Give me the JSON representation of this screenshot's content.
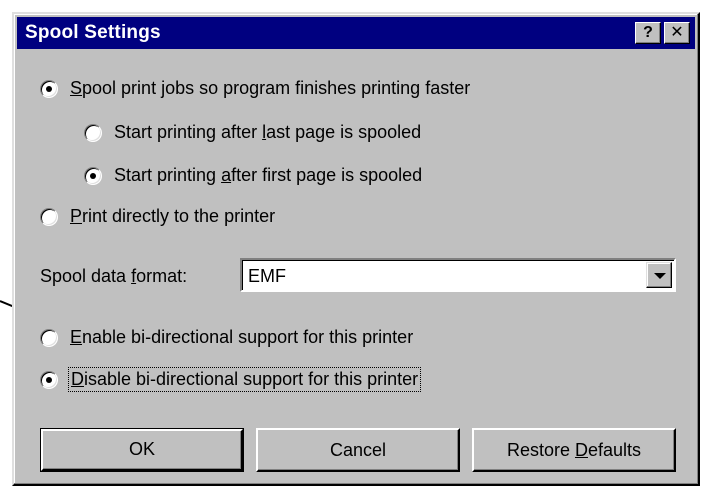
{
  "window": {
    "title": "Spool Settings",
    "help_glyph": "?",
    "close_glyph": "✕"
  },
  "spool_options": {
    "spool": {
      "pre": "",
      "key": "S",
      "post": "pool print jobs so program finishes printing faster",
      "selected": true
    },
    "after_last": {
      "pre": "Start printing after ",
      "key": "l",
      "post": "ast page is spooled",
      "selected": false
    },
    "after_first": {
      "pre": "Start printing ",
      "key": "a",
      "post": "fter first page is spooled",
      "selected": true
    },
    "direct": {
      "pre": "",
      "key": "P",
      "post": "rint directly to the printer",
      "selected": false
    }
  },
  "format": {
    "label_pre": "Spool data ",
    "label_key": "f",
    "label_post": "ormat:",
    "value": "EMF"
  },
  "bidi": {
    "enable": {
      "pre": "",
      "key": "E",
      "post": "nable bi-directional support for this printer",
      "selected": false
    },
    "disable": {
      "pre": "",
      "key": "D",
      "post": "isable bi-directional support for this printer",
      "selected": true
    }
  },
  "buttons": {
    "ok": "OK",
    "cancel": "Cancel",
    "restore_pre": "Restore ",
    "restore_key": "D",
    "restore_post": "efaults"
  }
}
